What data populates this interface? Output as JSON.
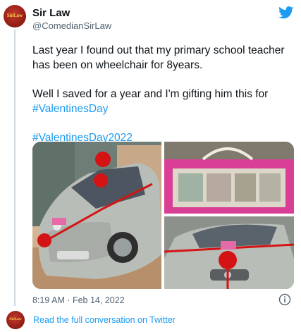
{
  "author": {
    "name": "Sir Law",
    "handle": "@ComedianSirLaw",
    "avatar_text": "SirLaw"
  },
  "tweet": {
    "line1": "Last year I found out that my primary school teacher has been on wheelchair for 8years.",
    "line2": "Well I saved for a year and I'm gifting him this for",
    "hashtag1": "#ValentinesDay",
    "hashtag2": "#ValentinesDay2022"
  },
  "media": [
    {
      "name": "photo-silver-suv-red-bows"
    },
    {
      "name": "photo-pink-gift-bag-cash"
    },
    {
      "name": "photo-suv-front-red-ribbon"
    }
  ],
  "timestamp": "8:19 AM · Feb 14, 2022",
  "footer": {
    "link_text": "Read the full conversation on Twitter"
  },
  "colors": {
    "link": "#1d9bf0",
    "muted": "#536471",
    "text": "#0f1419",
    "thread_line": "#cfd9de"
  }
}
